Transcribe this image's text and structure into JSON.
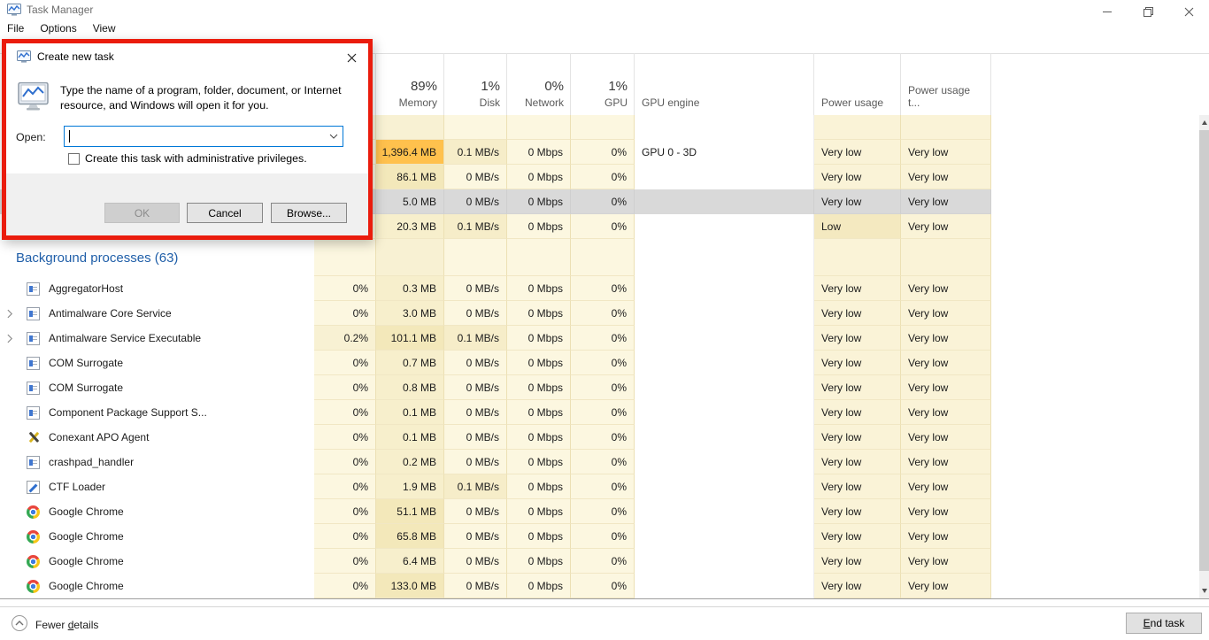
{
  "window": {
    "title": "Task Manager",
    "menu": [
      "File",
      "Options",
      "View"
    ]
  },
  "dialog": {
    "title": "Create new task",
    "instruction_line1": "Type the name of a program, folder, document, or Internet",
    "instruction_line2": "resource, and Windows will open it for you.",
    "open_label": "Open:",
    "open_value": "",
    "admin_checkbox_label": "Create this task with administrative privileges.",
    "admin_checkbox_checked": false,
    "buttons": {
      "ok": "OK",
      "cancel": "Cancel",
      "browse": "Browse..."
    }
  },
  "table": {
    "headers": {
      "memory_pct": "89%",
      "memory": "Memory",
      "disk_pct": "1%",
      "disk": "Disk",
      "network_pct": "0%",
      "network": "Network",
      "gpu_pct": "1%",
      "gpu": "GPU",
      "gpu_engine": "GPU engine",
      "power": "Power usage",
      "power_trend": "Power usage t..."
    },
    "apps_rows": [
      {
        "mem": "1,396.4 MB",
        "disk": "0.1 MB/s",
        "net": "0 Mbps",
        "gpu": "0%",
        "engine": "GPU 0 - 3D",
        "power": "Very low",
        "ptrend": "Very low"
      },
      {
        "mem": "86.1 MB",
        "disk": "0 MB/s",
        "net": "0 Mbps",
        "gpu": "0%",
        "engine": "",
        "power": "Very low",
        "ptrend": "Very low"
      },
      {
        "mem": "5.0 MB",
        "disk": "0 MB/s",
        "net": "0 Mbps",
        "gpu": "0%",
        "engine": "",
        "power": "Very low",
        "ptrend": "Very low"
      },
      {
        "mem": "20.3 MB",
        "disk": "0.1 MB/s",
        "net": "0 Mbps",
        "gpu": "0%",
        "engine": "",
        "power": "Low",
        "ptrend": "Very low"
      }
    ],
    "group_header": "Background processes (63)",
    "processes": [
      {
        "name": "AggregatorHost",
        "cpu": "0%",
        "mem": "0.3 MB",
        "disk": "0 MB/s",
        "net": "0 Mbps",
        "gpu": "0%",
        "power": "Very low",
        "ptrend": "Very low"
      },
      {
        "name": "Antimalware Core Service",
        "cpu": "0%",
        "mem": "3.0 MB",
        "disk": "0 MB/s",
        "net": "0 Mbps",
        "gpu": "0%",
        "power": "Very low",
        "ptrend": "Very low"
      },
      {
        "name": "Antimalware Service Executable",
        "cpu": "0.2%",
        "mem": "101.1 MB",
        "disk": "0.1 MB/s",
        "net": "0 Mbps",
        "gpu": "0%",
        "power": "Very low",
        "ptrend": "Very low"
      },
      {
        "name": "COM Surrogate",
        "cpu": "0%",
        "mem": "0.7 MB",
        "disk": "0 MB/s",
        "net": "0 Mbps",
        "gpu": "0%",
        "power": "Very low",
        "ptrend": "Very low"
      },
      {
        "name": "COM Surrogate",
        "cpu": "0%",
        "mem": "0.8 MB",
        "disk": "0 MB/s",
        "net": "0 Mbps",
        "gpu": "0%",
        "power": "Very low",
        "ptrend": "Very low"
      },
      {
        "name": "Component Package Support S...",
        "cpu": "0%",
        "mem": "0.1 MB",
        "disk": "0 MB/s",
        "net": "0 Mbps",
        "gpu": "0%",
        "power": "Very low",
        "ptrend": "Very low"
      },
      {
        "name": "Conexant APO Agent",
        "cpu": "0%",
        "mem": "0.1 MB",
        "disk": "0 MB/s",
        "net": "0 Mbps",
        "gpu": "0%",
        "power": "Very low",
        "ptrend": "Very low"
      },
      {
        "name": "crashpad_handler",
        "cpu": "0%",
        "mem": "0.2 MB",
        "disk": "0 MB/s",
        "net": "0 Mbps",
        "gpu": "0%",
        "power": "Very low",
        "ptrend": "Very low"
      },
      {
        "name": "CTF Loader",
        "cpu": "0%",
        "mem": "1.9 MB",
        "disk": "0.1 MB/s",
        "net": "0 Mbps",
        "gpu": "0%",
        "power": "Very low",
        "ptrend": "Very low"
      },
      {
        "name": "Google Chrome",
        "cpu": "0%",
        "mem": "51.1 MB",
        "disk": "0 MB/s",
        "net": "0 Mbps",
        "gpu": "0%",
        "power": "Very low",
        "ptrend": "Very low"
      },
      {
        "name": "Google Chrome",
        "cpu": "0%",
        "mem": "65.8 MB",
        "disk": "0 MB/s",
        "net": "0 Mbps",
        "gpu": "0%",
        "power": "Very low",
        "ptrend": "Very low"
      },
      {
        "name": "Google Chrome",
        "cpu": "0%",
        "mem": "6.4 MB",
        "disk": "0 MB/s",
        "net": "0 Mbps",
        "gpu": "0%",
        "power": "Very low",
        "ptrend": "Very low"
      },
      {
        "name": "Google Chrome",
        "cpu": "0%",
        "mem": "133.0 MB",
        "disk": "0 MB/s",
        "net": "0 Mbps",
        "gpu": "0%",
        "power": "Very low",
        "ptrend": "Very low"
      }
    ]
  },
  "footer": {
    "details_pre": "Fewer ",
    "details_key": "d",
    "details_post": "etails",
    "endtask_key": "E",
    "endtask_post": "nd task"
  },
  "icons": {
    "titlebar": "task-manager-icon",
    "dialog_title": "task-manager-icon",
    "dialog_body": "task-manager-monitor-icon",
    "process_default": "application-icon",
    "conexant": "tools-icon",
    "ctf_loader": "pen-icon",
    "google_chrome": "chrome-icon",
    "details_toggle": "chevron-up-circle-icon"
  },
  "colors": {
    "heat_high_orange": "#ffc14d",
    "heat_pale_yellow": "#fcf7e0",
    "selection_gray": "#d9d9d9",
    "group_header_blue": "#1f5ea8",
    "annotation_red": "#ea1c0d",
    "focus_blue": "#0078d7"
  }
}
